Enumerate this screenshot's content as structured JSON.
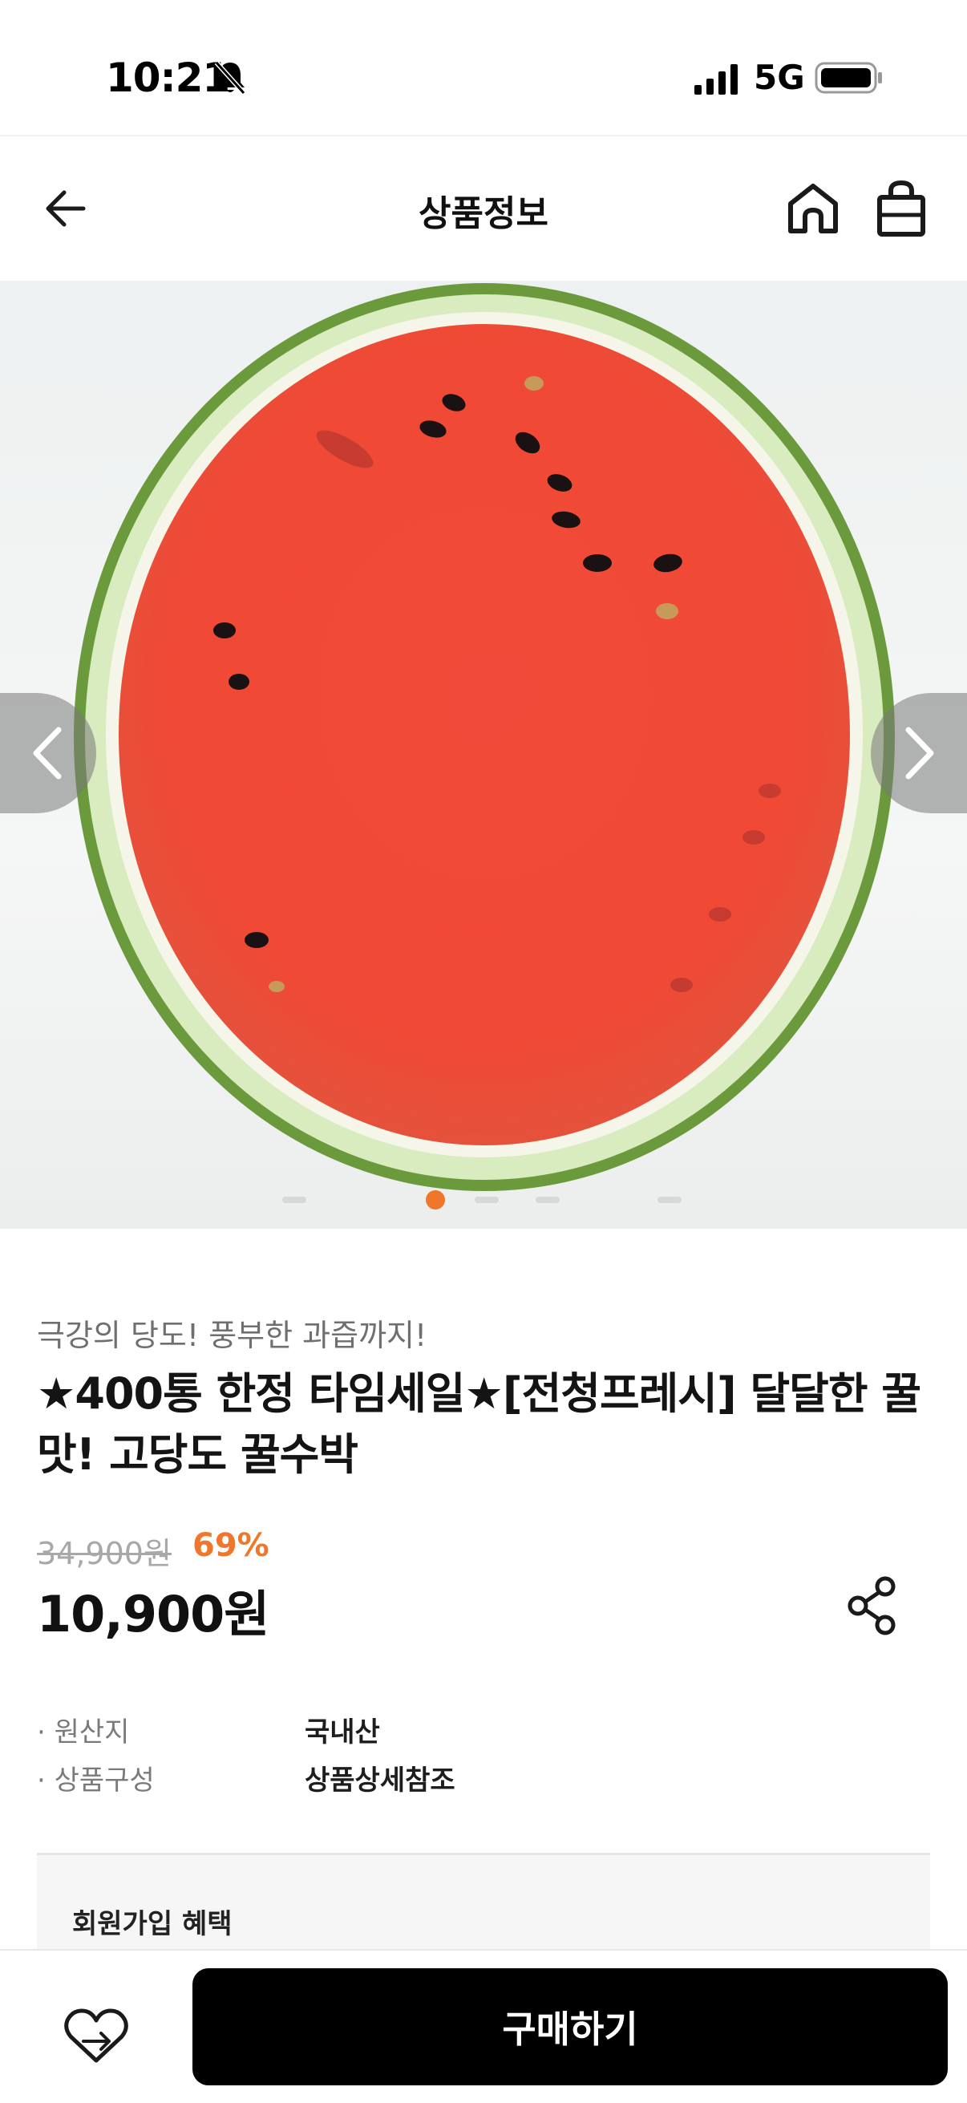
{
  "status_bar": {
    "time": "10:21",
    "network": "5G",
    "icons": [
      "bell-mute-icon",
      "signal-icon",
      "battery-icon"
    ]
  },
  "header": {
    "title": "상품정보",
    "icons": [
      "arrow-left-icon",
      "home-icon",
      "shopping-bag-icon"
    ]
  },
  "carousel": {
    "total_dots": 5,
    "active_index": 0,
    "accent_color": "#f0762a",
    "icons": [
      "chevron-left-icon",
      "chevron-right-icon"
    ]
  },
  "product": {
    "subtitle": "극강의 당도! 풍부한 과즙까지!",
    "title": "★400통 한정 타임세일★[전청프레시] 달달한 꿀맛! 고당도 꿀수박",
    "original_price": "34,900원",
    "discount_rate": "69%",
    "sale_price": "10,900원",
    "specs": [
      {
        "label": "· 원산지",
        "value": "국내산"
      },
      {
        "label": "· 상품구성",
        "value": "상품상세참조"
      }
    ]
  },
  "benefits": {
    "title": "회원가입 혜택"
  },
  "bottom_bar": {
    "buy_label": "구매하기",
    "icons": [
      "heart-icon"
    ]
  }
}
